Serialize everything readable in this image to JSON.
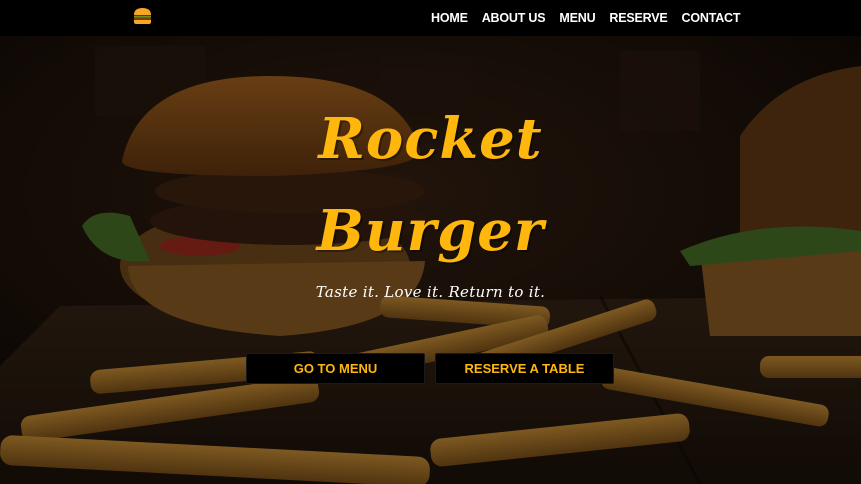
{
  "nav": {
    "logo_icon": "burger-icon",
    "links": [
      "HOME",
      "ABOUT US",
      "MENU",
      "RESERVE",
      "CONTACT"
    ]
  },
  "hero": {
    "title_line1": "Rocket",
    "title_line2": "Burger",
    "tagline": "Taste it. Love it. Return to it.",
    "buttons": {
      "menu": "GO TO MENU",
      "reserve": "RESERVE A TABLE"
    }
  },
  "colors": {
    "accent": "#ffb70d",
    "navbar_bg": "#000000",
    "button_bg": "#000000",
    "text_light": "#ffffff"
  }
}
